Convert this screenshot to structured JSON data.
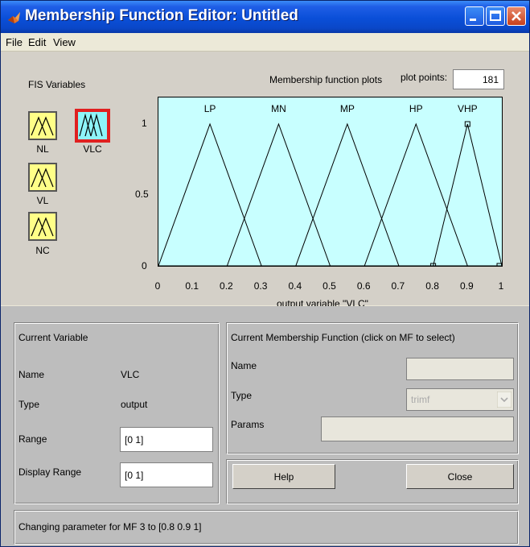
{
  "window": {
    "title": "Membership Function Editor: Untitled"
  },
  "menu": [
    "File",
    "Edit",
    "View"
  ],
  "fis_variables": {
    "heading": "FIS Variables",
    "items": [
      {
        "label": "NL",
        "selected": false
      },
      {
        "label": "VLC",
        "selected": true
      },
      {
        "label": "VL",
        "selected": false
      },
      {
        "label": "NC",
        "selected": false
      }
    ]
  },
  "plot": {
    "heading": "Membership function plots",
    "plot_points_label": "plot points:",
    "plot_points": "181",
    "xlabel": "output variable \"VLC\"",
    "y_ticks": [
      "1",
      "0.5",
      "0"
    ],
    "x_ticks": [
      "0",
      "0.1",
      "0.2",
      "0.3",
      "0.4",
      "0.5",
      "0.6",
      "0.7",
      "0.8",
      "0.9",
      "1"
    ]
  },
  "chart_data": {
    "type": "line",
    "xlabel": "output variable \"VLC\"",
    "xlim": [
      0,
      1
    ],
    "ylim": [
      0,
      1
    ],
    "series": [
      {
        "name": "LP",
        "params": [
          0,
          0.15,
          0.3
        ]
      },
      {
        "name": "MN",
        "params": [
          0.2,
          0.35,
          0.5
        ]
      },
      {
        "name": "MP",
        "params": [
          0.4,
          0.55,
          0.7
        ]
      },
      {
        "name": "HP",
        "params": [
          0.6,
          0.75,
          0.9
        ]
      },
      {
        "name": "VHP",
        "params": [
          0.8,
          0.9,
          1
        ]
      }
    ],
    "selected_series": "VHP"
  },
  "current_variable": {
    "heading": "Current Variable",
    "name_label": "Name",
    "name_value": "VLC",
    "type_label": "Type",
    "type_value": "output",
    "range_label": "Range",
    "range_value": "[0 1]",
    "display_range_label": "Display Range",
    "display_range_value": "[0 1]"
  },
  "current_mf": {
    "heading": "Current Membership Function (click on MF to select)",
    "name_label": "Name",
    "name_value": "",
    "type_label": "Type",
    "type_value": "trimf",
    "params_label": "Params",
    "params_value": ""
  },
  "buttons": {
    "help": "Help",
    "close": "Close"
  },
  "status": "Changing parameter for MF 3 to  [0.8 0.9 1]",
  "colors": {
    "plot_bg": "#c8ffff",
    "var_box": "#ffff88",
    "var_selected": "#8ef4f8",
    "selected_border": "#e02020"
  }
}
